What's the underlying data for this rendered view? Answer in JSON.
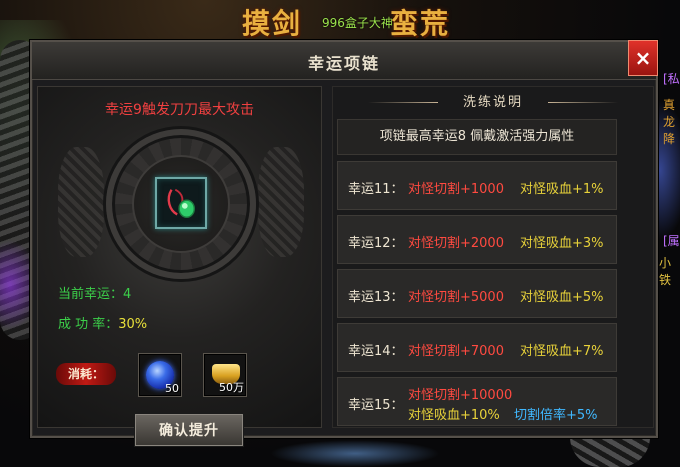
{
  "background": {
    "banner_left": "摸剑",
    "banner_right": "蛮荒",
    "banner_sub": "996盒子大神",
    "side_texts": [
      "[私",
      "真龙降",
      "[属",
      "小铁"
    ]
  },
  "panel": {
    "title": "幸运项链",
    "close_label": "×"
  },
  "left": {
    "headline": "幸运9触发刀刀最大攻击",
    "current_luck_label": "当前幸运：",
    "current_luck_value": "4",
    "success_rate_label": "成 功 率：",
    "success_rate_value": "30%",
    "consume_label": "消耗：",
    "materials": [
      {
        "icon": "blue-gem-icon",
        "count": "50"
      },
      {
        "icon": "gold-ingot-icon",
        "count": "50万"
      }
    ],
    "confirm_label": "确认提升"
  },
  "right": {
    "header": "洗练说明",
    "description": "项链最高幸运8  佩戴激活强力属性",
    "levels": [
      {
        "label": "幸运11：",
        "a": "对怪切割+1000",
        "b": "对怪吸血+1%"
      },
      {
        "label": "幸运12：",
        "a": "对怪切割+2000",
        "b": "对怪吸血+3%"
      },
      {
        "label": "幸运13：",
        "a": "对怪切割+5000",
        "b": "对怪吸血+5%"
      },
      {
        "label": "幸运14：",
        "a": "对怪切割+7000",
        "b": "对怪吸血+7%"
      },
      {
        "label": "幸运15：",
        "a": "对怪切割+10000",
        "b": "对怪吸血+10%",
        "c": "切割倍率+5%"
      }
    ]
  },
  "colors": {
    "red_text": "#ff4a40",
    "yellow_text": "#e8d23a",
    "green_text": "#3ccf4a",
    "blue_text": "#40b8ff"
  }
}
